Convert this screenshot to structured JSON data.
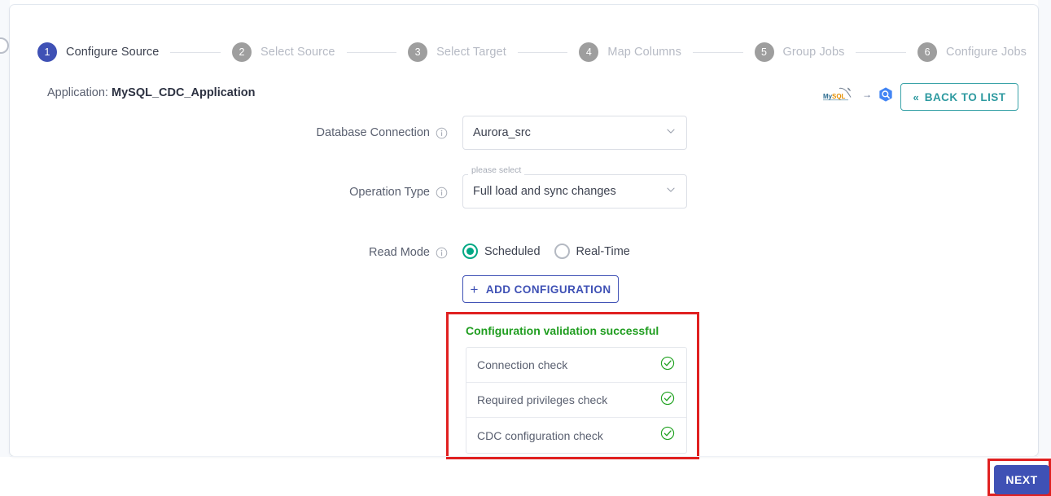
{
  "stepper": {
    "steps": [
      {
        "num": "1",
        "label": "Configure Source",
        "state": "active"
      },
      {
        "num": "2",
        "label": "Select Source",
        "state": "inactive"
      },
      {
        "num": "3",
        "label": "Select Target",
        "state": "inactive"
      },
      {
        "num": "4",
        "label": "Map Columns",
        "state": "inactive"
      },
      {
        "num": "5",
        "label": "Group Jobs",
        "state": "inactive"
      },
      {
        "num": "6",
        "label": "Configure Jobs",
        "state": "inactive"
      }
    ]
  },
  "header": {
    "application_prefix": "Application:",
    "application_name": "MySQL_CDC_Application",
    "source_icon": "mysql-logo-icon",
    "flow_arrow": "→",
    "target_icon": "bigquery-hex-icon",
    "back_button": "BACK TO LIST",
    "back_icon": "«"
  },
  "form": {
    "database_connection": {
      "label": "Database Connection",
      "info_icon": "info-icon",
      "value": "Aurora_src",
      "chevron": "chevron-down-icon"
    },
    "operation_type": {
      "label": "Operation Type",
      "info_icon": "info-icon",
      "floating_label": "please select",
      "value": "Full load and sync changes",
      "chevron": "chevron-down-icon"
    },
    "read_mode": {
      "label": "Read Mode",
      "info_icon": "info-icon",
      "options": [
        {
          "label": "Scheduled",
          "selected": true
        },
        {
          "label": "Real-Time",
          "selected": false
        }
      ]
    },
    "add_configuration": {
      "plus": "+",
      "label": "ADD CONFIGURATION"
    }
  },
  "validation": {
    "title": "Configuration validation successful",
    "title_color": "#1f9d1f",
    "highlight_color": "#e02020",
    "checks": [
      {
        "label": "Connection check",
        "status_icon": "check-circle-icon"
      },
      {
        "label": "Required privileges check",
        "status_icon": "check-circle-icon"
      },
      {
        "label": "CDC configuration check",
        "status_icon": "check-circle-icon"
      }
    ]
  },
  "footer": {
    "next_label": "NEXT",
    "next_color": "#3f51b5"
  }
}
